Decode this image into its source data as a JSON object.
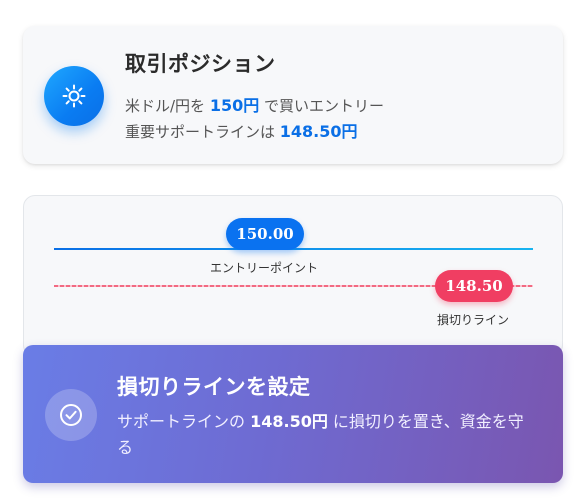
{
  "position_card": {
    "title": "取引ポジション",
    "line1_prefix": "米ドル/円を ",
    "entry_price": "150円",
    "line1_suffix": " で買いエントリー",
    "line2_prefix": "重要サポートラインは ",
    "support_price": "148.50円",
    "icon": "sun-icon",
    "accent_color": "#0a6fe6"
  },
  "chart": {
    "entry_value": "150.00",
    "entry_label": "エントリーポイント",
    "stop_value": "148.50",
    "stop_label": "損切りライン",
    "entry_color": "#0a72f0",
    "stop_color": "#f03e62"
  },
  "stop_card": {
    "title": "損切りラインを設定",
    "desc_prefix": "サポートラインの ",
    "desc_price": "148.50円",
    "desc_suffix": " に損切りを置き、資金を守る",
    "icon": "check-circle-icon"
  }
}
